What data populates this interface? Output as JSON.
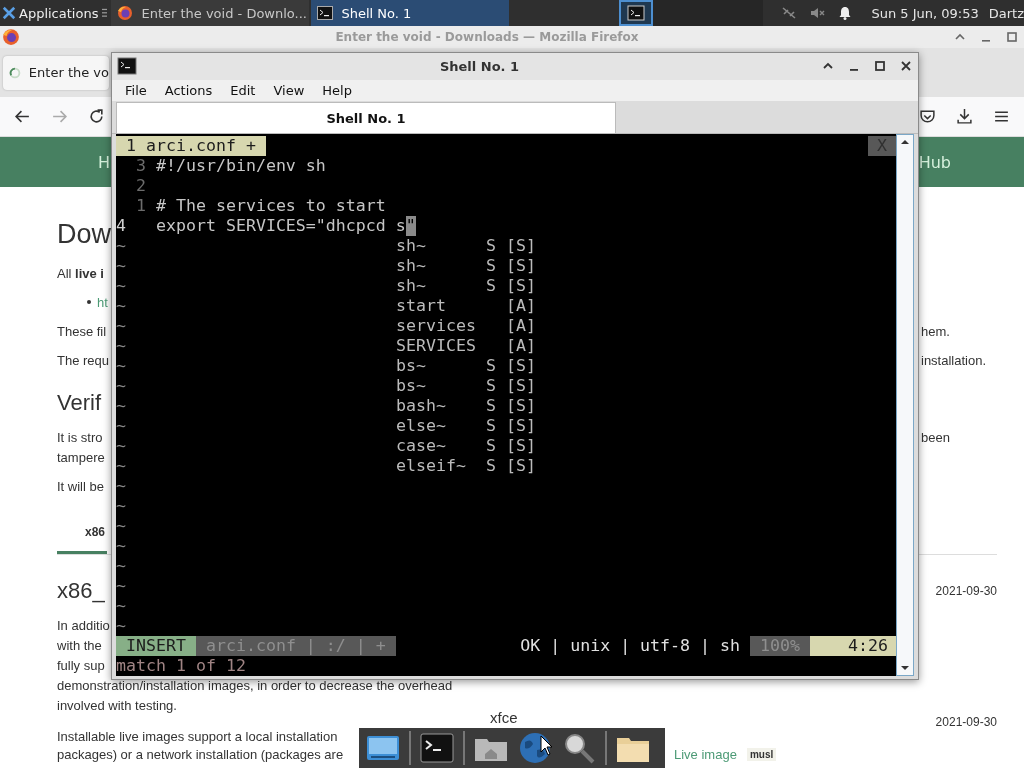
{
  "panel": {
    "apps_label": "Applications",
    "tasks": [
      {
        "kind": "firefox",
        "label": "Enter the void - Downlo...",
        "selected": false
      },
      {
        "kind": "terminal",
        "label": "Shell No. 1",
        "selected": true
      }
    ],
    "clock": "Sun  5 Jun, 09:53",
    "user": "Dartz"
  },
  "browser": {
    "title": "Enter the void - Downloads — Mozilla Firefox",
    "tab": "Enter the vo",
    "nav_left": "H",
    "nav_right": "Hub",
    "page": [
      {
        "kind": "h1",
        "lines": [
          {
            "left": "Dow"
          }
        ]
      },
      {
        "kind": "p",
        "lines": [
          {
            "left": "All **live i**"
          }
        ]
      },
      {
        "kind": "bullet",
        "lines": [
          {
            "left": "ht"
          }
        ]
      },
      {
        "kind": "p",
        "lines": [
          {
            "left": "These fil",
            "right": "hem."
          }
        ]
      },
      {
        "kind": "p",
        "lines": [
          {
            "left": "The requ",
            "right": "installation."
          }
        ]
      },
      {
        "kind": "h2",
        "lines": [
          {
            "left": "Verif"
          }
        ]
      },
      {
        "kind": "p",
        "lines": [
          {
            "left": "It is stro",
            "right": "been"
          },
          {
            "left": "tampere"
          }
        ]
      },
      {
        "kind": "p",
        "lines": [
          {
            "left": "It will be"
          }
        ]
      },
      {
        "kind": "tab",
        "lines": [
          {
            "left": "x86"
          }
        ]
      },
      {
        "kind": "h2",
        "lines": [
          {
            "left": "x86_",
            "right": "2021-09-30"
          }
        ]
      },
      {
        "kind": "p",
        "lines": [
          {
            "left": "In additio"
          },
          {
            "left": "with the"
          },
          {
            "left": "fully sup"
          },
          {
            "left": "demonstration/installation images, in order to decrease the overhead"
          },
          {
            "left": "involved with testing."
          }
        ]
      },
      {
        "kind": "edition",
        "lines": [
          {
            "center": "xfce",
            "right": "2021-09-30"
          }
        ]
      },
      {
        "kind": "p",
        "lines": [
          {
            "left": "Installable live images support a local installation"
          },
          {
            "left": "packages) or a network installation (packages are",
            "aside": "Live image",
            "tag": "musl"
          }
        ]
      }
    ]
  },
  "terminal": {
    "title": "Shell No. 1",
    "menu": [
      "File",
      "Actions",
      "Edit",
      "View",
      "Help"
    ],
    "tab": "Shell No. 1",
    "vim": {
      "tabline": {
        "label": "1 arci.conf +",
        "close": "X"
      },
      "lines": [
        {
          "number": "3",
          "text": "#!/usr/bin/env sh",
          "current": false
        },
        {
          "number": "2",
          "current": false
        },
        {
          "number": "1",
          "text": "# The services to start",
          "current": false
        },
        {
          "number": "4",
          "text": "export SERVICES=\"dhcpcd s",
          "cursor": "\"",
          "current": true
        }
      ],
      "filler": [
        "~",
        "~",
        "~",
        "~",
        "~",
        "~",
        "~",
        "~",
        "~",
        "~",
        "~",
        "~",
        "~",
        "~",
        "~",
        "~",
        "~",
        "~",
        "~",
        "~"
      ],
      "popup": [
        {
          "word": "sh~",
          "kind": "S",
          "menu": "[S]",
          "selected": false
        },
        {
          "word": "sh~",
          "kind": "S",
          "menu": "[S]",
          "selected": false
        },
        {
          "word": "sh~",
          "kind": "S",
          "menu": "[S]",
          "selected": false
        },
        {
          "word": "start",
          "menu": "[A]",
          "selected": false
        },
        {
          "word": "services",
          "menu": "[A]",
          "selected": false
        },
        {
          "word": "SERVICES",
          "menu": "[A]",
          "selected": false
        },
        {
          "word": "bs~",
          "kind": "S",
          "menu": "[S]",
          "selected": false
        },
        {
          "word": "bs~",
          "kind": "S",
          "menu": "[S]",
          "selected": false
        },
        {
          "word": "bash~",
          "kind": "S",
          "menu": "[S]",
          "selected": false
        },
        {
          "word": "else~",
          "kind": "S",
          "menu": "[S]",
          "selected": false
        },
        {
          "word": "case~",
          "kind": "S",
          "menu": "[S]",
          "selected": false
        },
        {
          "word": "elseif~",
          "kind": "S",
          "menu": "[S]",
          "selected": false
        }
      ],
      "status": {
        "mode": "INSERT",
        "file": "arci.conf | :/ | +",
        "info": "OK | unix | utf-8 | sh",
        "percent": "100%",
        "position": "4:26"
      },
      "cmdline": "match 1 of 12"
    }
  },
  "dock": {
    "items": [
      {
        "kind": "desktop"
      },
      {
        "kind": "separator"
      },
      {
        "kind": "terminal"
      },
      {
        "kind": "separator"
      },
      {
        "kind": "home"
      },
      {
        "kind": "globe"
      },
      {
        "kind": "search"
      },
      {
        "kind": "separator"
      },
      {
        "kind": "folder"
      }
    ]
  }
}
